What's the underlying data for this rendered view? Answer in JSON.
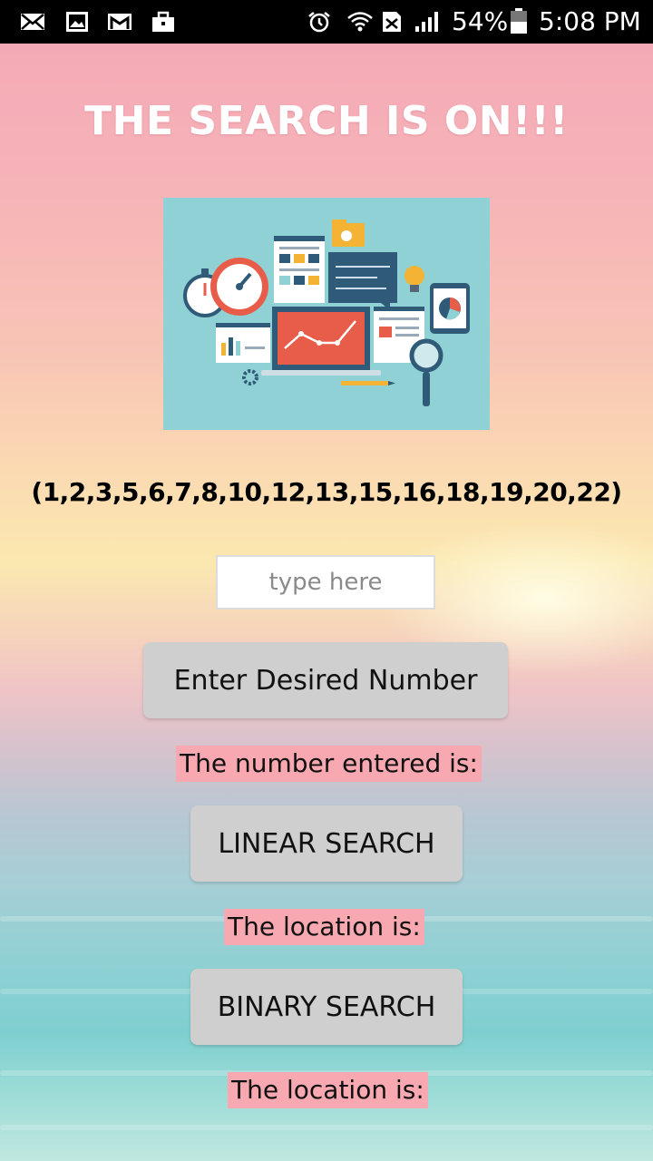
{
  "status_bar": {
    "battery": "54%",
    "time": "5:08 PM",
    "left_icons": [
      "mail-icon",
      "image-icon",
      "gmail-icon",
      "briefcase-icon"
    ],
    "right_icons": [
      "alarm-icon",
      "wifi-icon",
      "sim-icon",
      "signal-icon",
      "battery-icon"
    ]
  },
  "app": {
    "title": "THE SEARCH IS ON!!!",
    "numbers": "(1,2,3,5,6,7,8,10,12,13,15,16,18,19,20,22)",
    "input_placeholder": "type here",
    "enter_button": "Enter Desired Number",
    "number_entered_label": "The number entered is:",
    "linear_button": "LINEAR SEARCH",
    "linear_location_label": "The location is:",
    "binary_button": "BINARY SEARCH",
    "binary_location_label": "The location is:"
  },
  "colors": {
    "button_bg": "#cfcfcf",
    "label_bg": "#f7a8b0",
    "hero_bg": "#8fd1d4"
  }
}
